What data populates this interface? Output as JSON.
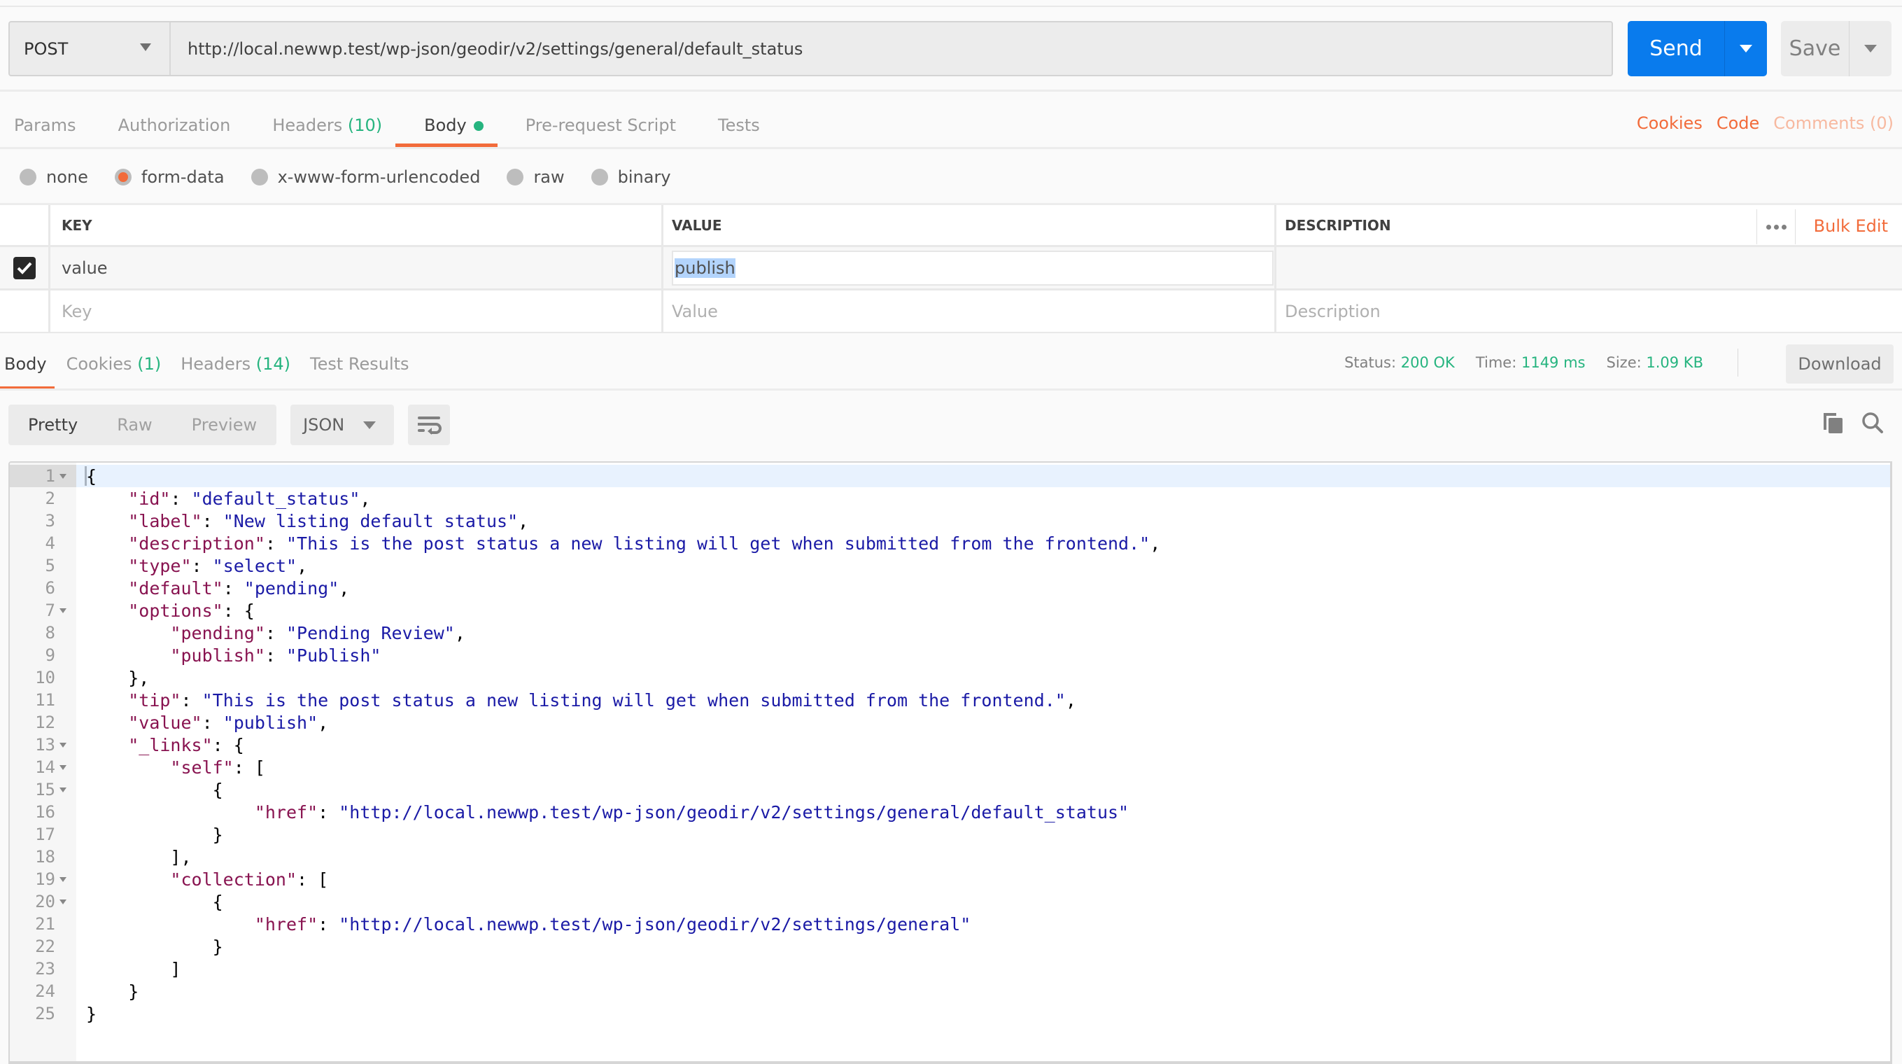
{
  "request": {
    "method": "POST",
    "url": "http://local.newwp.test/wp-json/geodir/v2/settings/general/default_status",
    "send_label": "Send",
    "save_label": "Save"
  },
  "request_tabs": [
    {
      "label": "Params",
      "count": null
    },
    {
      "label": "Authorization",
      "count": null
    },
    {
      "label": "Headers",
      "count": "(10)"
    },
    {
      "label": "Body",
      "count": null,
      "active": true,
      "has_dot": true
    },
    {
      "label": "Pre-request Script",
      "count": null
    },
    {
      "label": "Tests",
      "count": null
    }
  ],
  "right_links": {
    "cookies": "Cookies",
    "code": "Code",
    "comments": "Comments (0)"
  },
  "body_types": [
    {
      "label": "none",
      "selected": false
    },
    {
      "label": "form-data",
      "selected": true
    },
    {
      "label": "x-www-form-urlencoded",
      "selected": false
    },
    {
      "label": "raw",
      "selected": false
    },
    {
      "label": "binary",
      "selected": false
    }
  ],
  "form_table": {
    "headers": {
      "key": "KEY",
      "value": "VALUE",
      "description": "DESCRIPTION"
    },
    "bulk_edit": "Bulk Edit",
    "rows": [
      {
        "checked": true,
        "key": "value",
        "value": "publish",
        "description": ""
      }
    ],
    "placeholders": {
      "key": "Key",
      "value": "Value",
      "description": "Description"
    }
  },
  "response_tabs": [
    {
      "label": "Body",
      "count": null,
      "active": true
    },
    {
      "label": "Cookies",
      "count": "(1)"
    },
    {
      "label": "Headers",
      "count": "(14)"
    },
    {
      "label": "Test Results",
      "count": null
    }
  ],
  "response_status": {
    "status_label": "Status:",
    "status": "200 OK",
    "time_label": "Time:",
    "time": "1149 ms",
    "size_label": "Size:",
    "size": "1.09 KB",
    "download_label": "Download"
  },
  "view_modes": [
    {
      "label": "Pretty",
      "active": true
    },
    {
      "label": "Raw",
      "active": false
    },
    {
      "label": "Preview",
      "active": false
    }
  ],
  "format": "JSON",
  "icons": {
    "wrap": "wrap-lines-icon",
    "copy": "copy-icon",
    "search": "search-icon"
  },
  "colors": {
    "accent": "#f26b3a",
    "send": "#097bed",
    "success": "#26b47f",
    "json_key": "#881350",
    "json_string": "#1a1aa6"
  },
  "code_lines": [
    {
      "n": 1,
      "fold": true,
      "indent": 0,
      "parts": [
        [
          "p",
          "{"
        ]
      ]
    },
    {
      "n": 2,
      "indent": 1,
      "parts": [
        [
          "k",
          "\"id\""
        ],
        [
          "p",
          ": "
        ],
        [
          "s",
          "\"default_status\""
        ],
        [
          "p",
          ","
        ]
      ]
    },
    {
      "n": 3,
      "indent": 1,
      "parts": [
        [
          "k",
          "\"label\""
        ],
        [
          "p",
          ": "
        ],
        [
          "s",
          "\"New listing default status\""
        ],
        [
          "p",
          ","
        ]
      ]
    },
    {
      "n": 4,
      "indent": 1,
      "parts": [
        [
          "k",
          "\"description\""
        ],
        [
          "p",
          ": "
        ],
        [
          "s",
          "\"This is the post status a new listing will get when submitted from the frontend.\""
        ],
        [
          "p",
          ","
        ]
      ]
    },
    {
      "n": 5,
      "indent": 1,
      "parts": [
        [
          "k",
          "\"type\""
        ],
        [
          "p",
          ": "
        ],
        [
          "s",
          "\"select\""
        ],
        [
          "p",
          ","
        ]
      ]
    },
    {
      "n": 6,
      "indent": 1,
      "parts": [
        [
          "k",
          "\"default\""
        ],
        [
          "p",
          ": "
        ],
        [
          "s",
          "\"pending\""
        ],
        [
          "p",
          ","
        ]
      ]
    },
    {
      "n": 7,
      "fold": true,
      "indent": 1,
      "parts": [
        [
          "k",
          "\"options\""
        ],
        [
          "p",
          ": {"
        ]
      ]
    },
    {
      "n": 8,
      "indent": 2,
      "parts": [
        [
          "k",
          "\"pending\""
        ],
        [
          "p",
          ": "
        ],
        [
          "s",
          "\"Pending Review\""
        ],
        [
          "p",
          ","
        ]
      ]
    },
    {
      "n": 9,
      "indent": 2,
      "parts": [
        [
          "k",
          "\"publish\""
        ],
        [
          "p",
          ": "
        ],
        [
          "s",
          "\"Publish\""
        ]
      ]
    },
    {
      "n": 10,
      "indent": 1,
      "parts": [
        [
          "p",
          "},"
        ]
      ]
    },
    {
      "n": 11,
      "indent": 1,
      "parts": [
        [
          "k",
          "\"tip\""
        ],
        [
          "p",
          ": "
        ],
        [
          "s",
          "\"This is the post status a new listing will get when submitted from the frontend.\""
        ],
        [
          "p",
          ","
        ]
      ]
    },
    {
      "n": 12,
      "indent": 1,
      "parts": [
        [
          "k",
          "\"value\""
        ],
        [
          "p",
          ": "
        ],
        [
          "s",
          "\"publish\""
        ],
        [
          "p",
          ","
        ]
      ]
    },
    {
      "n": 13,
      "fold": true,
      "indent": 1,
      "parts": [
        [
          "k",
          "\"_links\""
        ],
        [
          "p",
          ": {"
        ]
      ]
    },
    {
      "n": 14,
      "fold": true,
      "indent": 2,
      "parts": [
        [
          "k",
          "\"self\""
        ],
        [
          "p",
          ": ["
        ]
      ]
    },
    {
      "n": 15,
      "fold": true,
      "indent": 3,
      "parts": [
        [
          "p",
          "{"
        ]
      ]
    },
    {
      "n": 16,
      "indent": 4,
      "parts": [
        [
          "k",
          "\"href\""
        ],
        [
          "p",
          ": "
        ],
        [
          "s",
          "\"http://local.newwp.test/wp-json/geodir/v2/settings/general/default_status\""
        ]
      ]
    },
    {
      "n": 17,
      "indent": 3,
      "parts": [
        [
          "p",
          "}"
        ]
      ]
    },
    {
      "n": 18,
      "indent": 2,
      "parts": [
        [
          "p",
          "],"
        ]
      ]
    },
    {
      "n": 19,
      "fold": true,
      "indent": 2,
      "parts": [
        [
          "k",
          "\"collection\""
        ],
        [
          "p",
          ": ["
        ]
      ]
    },
    {
      "n": 20,
      "fold": true,
      "indent": 3,
      "parts": [
        [
          "p",
          "{"
        ]
      ]
    },
    {
      "n": 21,
      "indent": 4,
      "parts": [
        [
          "k",
          "\"href\""
        ],
        [
          "p",
          ": "
        ],
        [
          "s",
          "\"http://local.newwp.test/wp-json/geodir/v2/settings/general\""
        ]
      ]
    },
    {
      "n": 22,
      "indent": 3,
      "parts": [
        [
          "p",
          "}"
        ]
      ]
    },
    {
      "n": 23,
      "indent": 2,
      "parts": [
        [
          "p",
          "]"
        ]
      ]
    },
    {
      "n": 24,
      "indent": 1,
      "parts": [
        [
          "p",
          "}"
        ]
      ]
    },
    {
      "n": 25,
      "indent": 0,
      "parts": [
        [
          "p",
          "}"
        ]
      ]
    }
  ]
}
